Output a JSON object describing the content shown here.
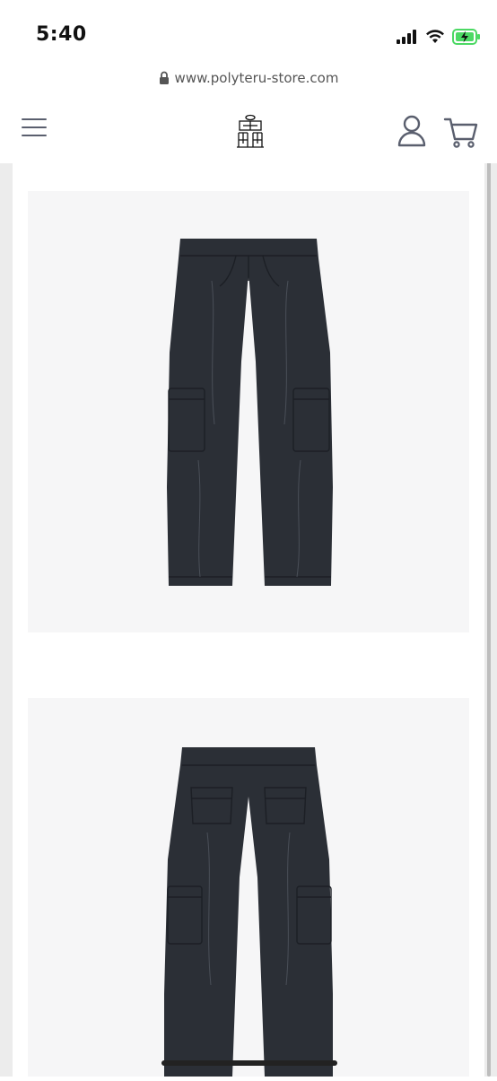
{
  "status_bar": {
    "time": "5:40"
  },
  "browser": {
    "url": "www.polyteru-store.com"
  },
  "header": {
    "menu_icon": "hamburger-menu-icon",
    "logo": "polyteru-logo",
    "account_icon": "account-icon",
    "cart_icon": "cart-icon"
  },
  "products": {
    "images": [
      {
        "subject": "cargo pants front view",
        "color": "#2b2f36"
      },
      {
        "subject": "cargo pants back view",
        "color": "#2b2f36"
      }
    ]
  },
  "colors": {
    "icon_gray": "#5a5f6e",
    "image_bg": "#f6f6f7",
    "garment": "#2b2f36"
  }
}
